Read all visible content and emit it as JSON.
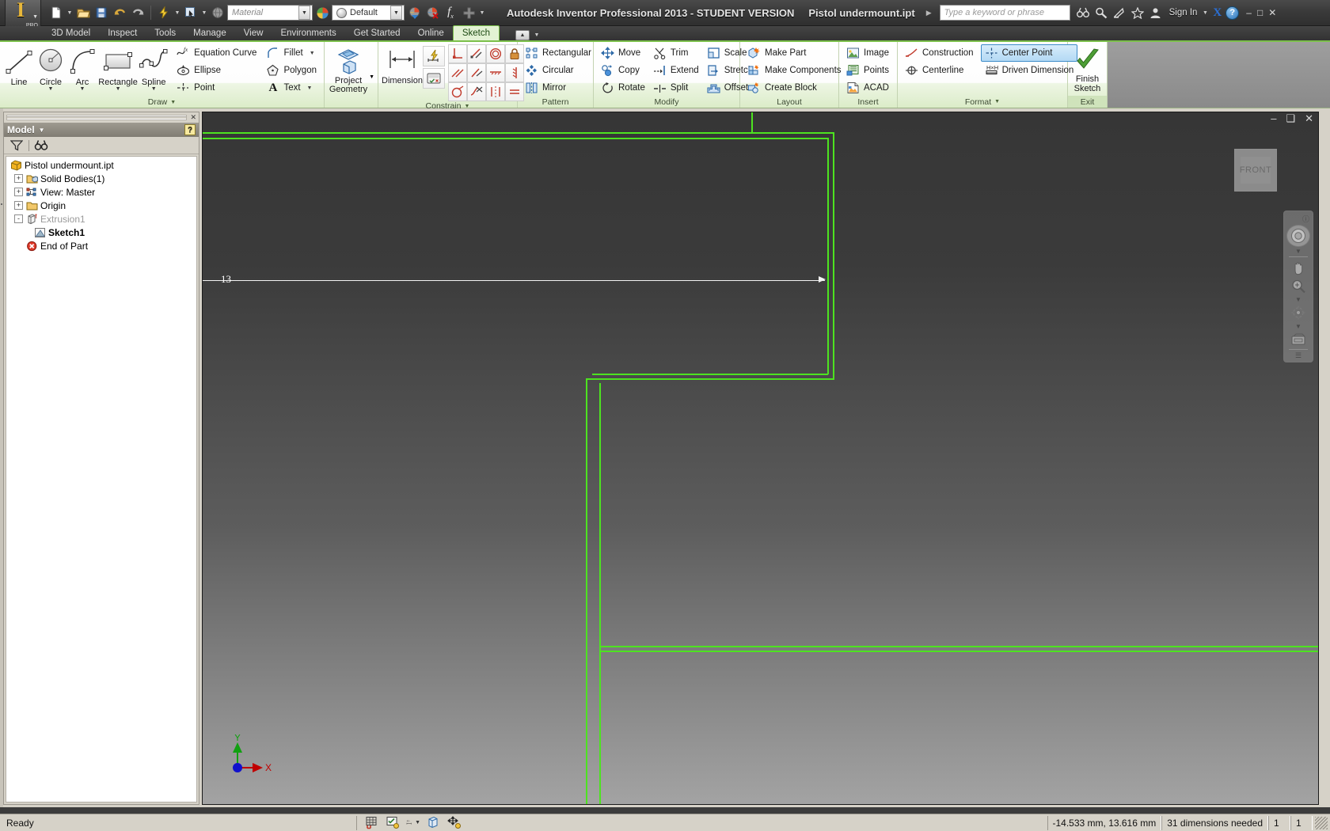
{
  "title_bar": {
    "app_title": "Autodesk Inventor Professional 2013 - STUDENT VERSION",
    "document_name": "Pistol undermount.ipt",
    "search_placeholder": "Type a keyword or phrase",
    "sign_in": "Sign In",
    "material_value": "Material",
    "appearance_value": "Default",
    "icons": [
      "new-icon",
      "open-icon",
      "save-icon",
      "undo-icon",
      "redo-icon",
      "update-icon",
      "select-icon",
      "material-sphere-icon",
      "appearance-icon",
      "appearance-clear-icon",
      "parameters-icon",
      "plus-icon"
    ],
    "window_buttons": [
      "minimize",
      "restore",
      "close"
    ],
    "help_label": "?",
    "x_brand": "X"
  },
  "ribbon_tabs": {
    "tabs": [
      {
        "label": "3D Model",
        "active": false
      },
      {
        "label": "Inspect",
        "active": false
      },
      {
        "label": "Tools",
        "active": false
      },
      {
        "label": "Manage",
        "active": false
      },
      {
        "label": "View",
        "active": false
      },
      {
        "label": "Environments",
        "active": false
      },
      {
        "label": "Get Started",
        "active": false
      },
      {
        "label": "Online",
        "active": false
      },
      {
        "label": "Sketch",
        "active": true
      }
    ]
  },
  "ribbon": {
    "panels": [
      {
        "title": "Draw",
        "has_dropdown": true,
        "big_buttons": [
          {
            "label": "Line",
            "icon": "line-icon",
            "dropdown": false
          },
          {
            "label": "Circle",
            "icon": "circle-icon",
            "dropdown": true
          },
          {
            "label": "Arc",
            "icon": "arc-icon",
            "dropdown": true
          },
          {
            "label": "Rectangle",
            "icon": "rectangle-icon",
            "dropdown": true
          },
          {
            "label": "Spline",
            "icon": "spline-icon",
            "dropdown": true
          }
        ],
        "small_buttons_col1": [
          {
            "label": "Equation Curve",
            "icon": "equation-curve-icon",
            "dropdown": false
          },
          {
            "label": "Ellipse",
            "icon": "ellipse-icon",
            "dropdown": false
          },
          {
            "label": "Point",
            "icon": "point-icon",
            "dropdown": false
          }
        ],
        "small_buttons_col2": [
          {
            "label": "Fillet",
            "icon": "fillet-icon",
            "dropdown": true
          },
          {
            "label": "Polygon",
            "icon": "polygon-icon",
            "dropdown": false
          },
          {
            "label": "Text",
            "icon": "text-icon",
            "dropdown": true
          }
        ]
      },
      {
        "title": "",
        "big_buttons": [
          {
            "label": "Project Geometry",
            "icon": "project-geometry-icon",
            "dropdown": true
          }
        ]
      },
      {
        "title": "Constrain",
        "has_dropdown": true,
        "big_buttons": [
          {
            "label": "Dimension",
            "icon": "dimension-icon",
            "dropdown": false
          }
        ],
        "tool_icons": [
          "auto-dimension-icon",
          "show-constraints-icon",
          "perpendicular-icon",
          "parallel-icon",
          "tangent-icon",
          "fix-icon",
          "coincident-icon",
          "collinear-icon",
          "horizontal-icon",
          "vertical-icon",
          "concentric-icon",
          "smooth-icon",
          "symmetric-icon",
          "equal-icon"
        ]
      },
      {
        "title": "Pattern",
        "small_buttons": [
          {
            "label": "Rectangular",
            "icon": "rectangular-pattern-icon"
          },
          {
            "label": "Circular",
            "icon": "circular-pattern-icon"
          },
          {
            "label": "Mirror",
            "icon": "mirror-icon"
          }
        ]
      },
      {
        "title": "Modify",
        "small_buttons_col1": [
          {
            "label": "Move",
            "icon": "move-icon"
          },
          {
            "label": "Copy",
            "icon": "copy-icon"
          },
          {
            "label": "Rotate",
            "icon": "rotate-icon"
          }
        ],
        "small_buttons_col2": [
          {
            "label": "Trim",
            "icon": "trim-icon"
          },
          {
            "label": "Extend",
            "icon": "extend-icon"
          },
          {
            "label": "Split",
            "icon": "split-icon"
          }
        ],
        "small_buttons_col3": [
          {
            "label": "Scale",
            "icon": "scale-icon"
          },
          {
            "label": "Stretch",
            "icon": "stretch-icon"
          },
          {
            "label": "Offset",
            "icon": "offset-icon"
          }
        ]
      },
      {
        "title": "Layout",
        "small_buttons": [
          {
            "label": "Make Part",
            "icon": "make-part-icon"
          },
          {
            "label": "Make Components",
            "icon": "make-components-icon"
          },
          {
            "label": "Create Block",
            "icon": "create-block-icon"
          }
        ]
      },
      {
        "title": "Insert",
        "small_buttons": [
          {
            "label": "Image",
            "icon": "image-icon"
          },
          {
            "label": "Points",
            "icon": "points-icon"
          },
          {
            "label": "ACAD",
            "icon": "acad-icon"
          }
        ]
      },
      {
        "title": "Format",
        "has_dropdown": true,
        "small_buttons_col1": [
          {
            "label": "Construction",
            "icon": "construction-icon",
            "selected": false
          },
          {
            "label": "Centerline",
            "icon": "centerline-icon",
            "selected": false
          }
        ],
        "small_buttons_col2": [
          {
            "label": "Center Point",
            "icon": "center-point-icon",
            "selected": true
          },
          {
            "label": "Driven Dimension",
            "icon": "driven-dimension-icon",
            "selected": false
          }
        ]
      },
      {
        "title": "Exit",
        "big_buttons": [
          {
            "label": "Finish Sketch",
            "icon": "finish-sketch-checkmark-icon",
            "dropdown": false
          }
        ]
      }
    ]
  },
  "browser": {
    "panel_title": "Model",
    "help_badge": "?",
    "tools": [
      "filter-icon",
      "find-icon"
    ],
    "tree": [
      {
        "label": "Pistol undermount.ipt",
        "icon": "part-document-icon",
        "indent": 0,
        "expander": "",
        "style": "normal"
      },
      {
        "label": "Solid Bodies(1)",
        "icon": "solid-bodies-folder-icon",
        "indent": 1,
        "expander": "+",
        "style": "normal"
      },
      {
        "label": "View: Master",
        "icon": "view-master-icon",
        "indent": 1,
        "expander": "+",
        "style": "normal"
      },
      {
        "label": "Origin",
        "icon": "origin-folder-icon",
        "indent": 1,
        "expander": "+",
        "style": "normal"
      },
      {
        "label": "Extrusion1",
        "icon": "extrusion-icon",
        "indent": 1,
        "expander": "-",
        "style": "dim"
      },
      {
        "label": "Sketch1",
        "icon": "sketch-icon",
        "indent": 2,
        "expander": "",
        "style": "bold"
      },
      {
        "label": "End of Part",
        "icon": "end-of-part-icon",
        "indent": 1,
        "expander": "",
        "style": "normal"
      }
    ]
  },
  "canvas": {
    "view_cube_label": "FRONT",
    "dimension_label": "13",
    "axis_labels": {
      "x": "X",
      "y": "Y"
    },
    "sketch_color": "#4de320",
    "dimension_color": "#ffffff",
    "window_buttons": [
      "minimize",
      "restore",
      "close"
    ],
    "navbar_items": [
      "steering-wheel-icon",
      "pan-icon",
      "zoom-icon",
      "orbit-icon",
      "look-at-icon"
    ],
    "navbar_close": "close-icon"
  },
  "status_bar": {
    "message": "Ready",
    "icons": [
      "snap-grid-icon",
      "constraint-display-icon",
      "dimension-display-icon",
      "slice-graphics-icon",
      "autoproject-icon"
    ],
    "coordinates": "-14.533 mm, 13.616 mm",
    "dimensions_needed": "31 dimensions needed",
    "field_a": "1",
    "field_b": "1"
  }
}
